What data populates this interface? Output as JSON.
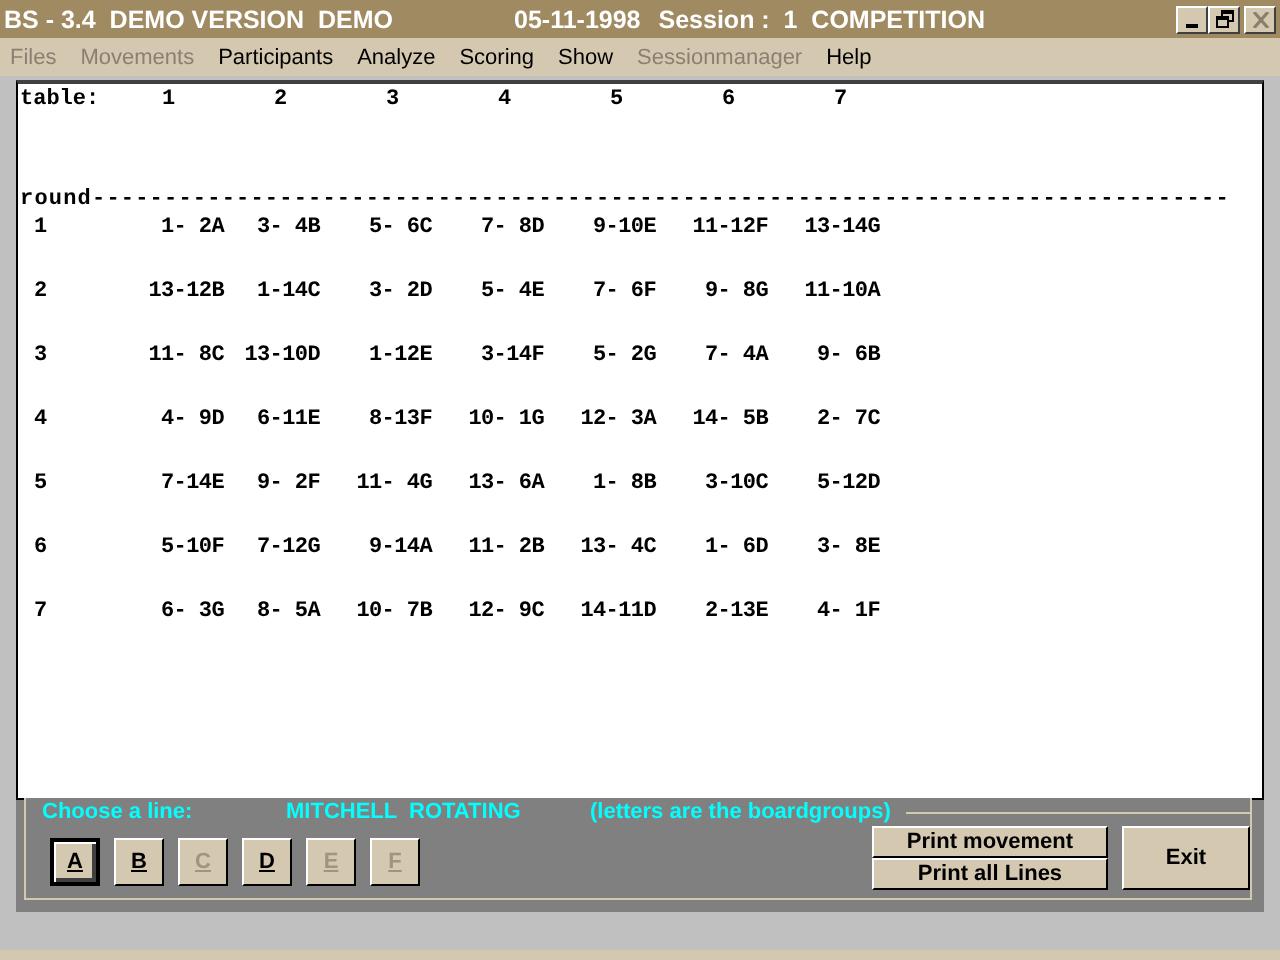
{
  "window": {
    "title": "BS - 3.4  DEMO VERSION  DEMO",
    "date": "05-11-1998",
    "session": "Session :  1  COMPETITION"
  },
  "menu": [
    {
      "label": "Files",
      "disabled": true
    },
    {
      "label": "Movements",
      "disabled": true
    },
    {
      "label": "Participants",
      "disabled": false
    },
    {
      "label": "Analyze",
      "disabled": false
    },
    {
      "label": "Scoring",
      "disabled": false
    },
    {
      "label": "Show",
      "disabled": false
    },
    {
      "label": "Sessionmanager",
      "disabled": true
    },
    {
      "label": "Help",
      "disabled": false
    }
  ],
  "movement": {
    "table_label": "table:",
    "tables": [
      "1",
      "2",
      "3",
      "4",
      "5",
      "6",
      "7"
    ],
    "round_rule": "round-------------------------------------------------------------------------------",
    "rounds": [
      {
        "round": "1",
        "cells": [
          "1- 2A",
          "3- 4B",
          "5- 6C",
          "7- 8D",
          "9-10E",
          "11-12F",
          "13-14G"
        ]
      },
      {
        "round": "2",
        "cells": [
          "13-12B",
          "1-14C",
          "3- 2D",
          "5- 4E",
          "7- 6F",
          "9- 8G",
          "11-10A"
        ]
      },
      {
        "round": "3",
        "cells": [
          "11- 8C",
          "13-10D",
          "1-12E",
          "3-14F",
          "5- 2G",
          "7- 4A",
          "9- 6B"
        ]
      },
      {
        "round": "4",
        "cells": [
          "4- 9D",
          "6-11E",
          "8-13F",
          "10- 1G",
          "12- 3A",
          "14- 5B",
          "2- 7C"
        ]
      },
      {
        "round": "5",
        "cells": [
          "7-14E",
          "9- 2F",
          "11- 4G",
          "13- 6A",
          "1- 8B",
          "3-10C",
          "5-12D"
        ]
      },
      {
        "round": "6",
        "cells": [
          "5-10F",
          "7-12G",
          "9-14A",
          "11- 2B",
          "13- 4C",
          "1- 6D",
          "3- 8E"
        ]
      },
      {
        "round": "7",
        "cells": [
          "6- 3G",
          "8- 5A",
          "10- 7B",
          "12- 9C",
          "14-11D",
          "2-13E",
          "4- 1F"
        ]
      }
    ]
  },
  "line_panel": {
    "legend": "Choose a line:",
    "mode": "MITCHELL  ROTATING",
    "note": "(letters are the boardgroups)",
    "lines": [
      {
        "label": "A",
        "selected": true,
        "disabled": false
      },
      {
        "label": "B",
        "selected": false,
        "disabled": false
      },
      {
        "label": "C",
        "selected": false,
        "disabled": true
      },
      {
        "label": "D",
        "selected": false,
        "disabled": false
      },
      {
        "label": "E",
        "selected": false,
        "disabled": true
      },
      {
        "label": "F",
        "selected": false,
        "disabled": true
      }
    ],
    "print_buttons": [
      "Print movement",
      "Print all Lines"
    ],
    "exit_button": "Exit"
  }
}
